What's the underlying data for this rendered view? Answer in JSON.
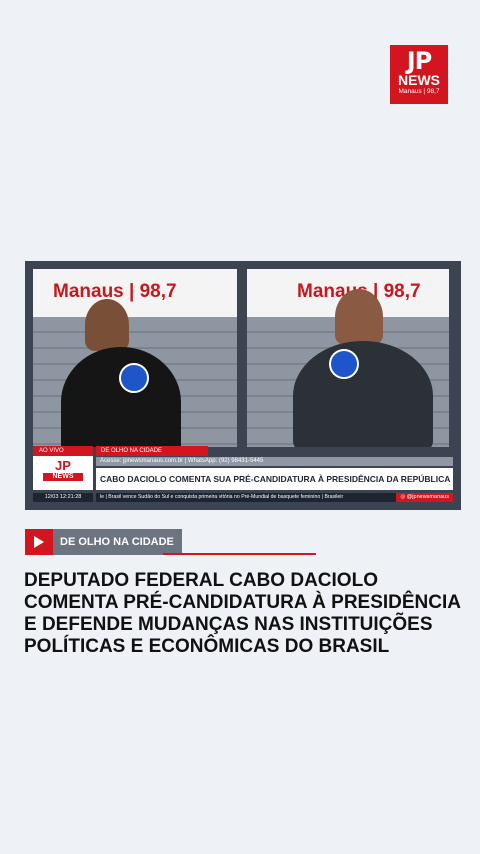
{
  "logo": {
    "mark": "JP",
    "name": "NEWS",
    "location": "Manaus | 98,7"
  },
  "video": {
    "studio_banner_left": "Manaus | 98,7",
    "studio_banner_right": "Manaus | 98,7",
    "live_badge": "AO VIVO",
    "category": "DE OLHO NA CIDADE",
    "lower_logo_mark": "JP",
    "lower_logo_name": "NEWS",
    "clock": "12/03 12:21:28",
    "access_line": "Acesse: jpnewsmanaus.com.br | WhatsApp: (92) 98431-5445",
    "headline": "CABO DACIOLO COMENTA SUA PRÉ-CANDIDATURA À PRESIDÊNCIA DA REPÚBLICA",
    "crawl": "le | Brasil vence Sudão do Sul e conquista primeira vitória no Pré-Mundial de basquete feminino | Brasileir",
    "instagram": "@jpnewsmanaus"
  },
  "article": {
    "section_tag": "DE OLHO NA CIDADE",
    "title": "DEPUTADO FEDERAL CABO DACIOLO COMENTA PRÉ-CANDIDATURA À PRESIDÊNCIA E DEFENDE MUDANÇAS NAS INSTITUIÇÕES POLÍTICAS E ECONÔMICAS DO BRASIL"
  },
  "colors": {
    "brand_red": "#d2151f",
    "background": "#eef1f6",
    "tag_gray": "#6c7480"
  }
}
